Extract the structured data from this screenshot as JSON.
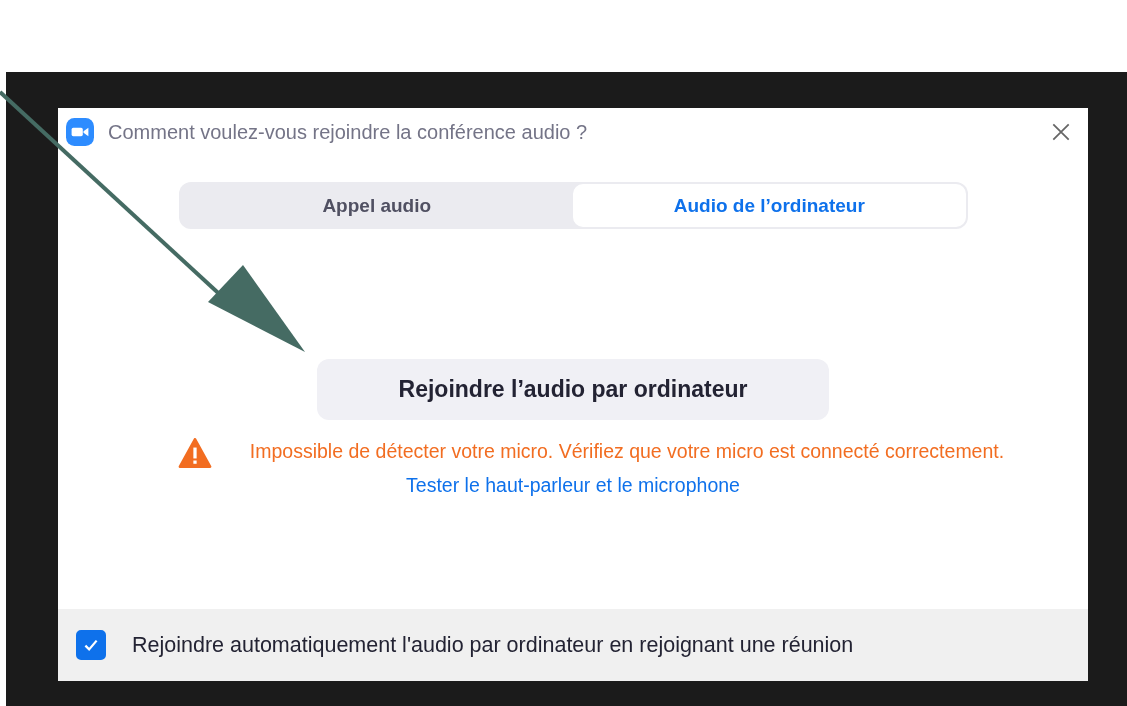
{
  "dialog": {
    "title": "Comment voulez-vous rejoindre la conférence audio ?"
  },
  "tabs": [
    {
      "label": "Appel audio",
      "selected": false
    },
    {
      "label": "Audio de l’ordinateur",
      "selected": true
    }
  ],
  "join_button": "Rejoindre l’audio par ordinateur",
  "warning": "Impossible de détecter votre micro. Vérifiez que votre micro est connecté correctement.",
  "test_link": "Tester le haut-parleur et le microphone",
  "auto_join": {
    "label": "Rejoindre automatiquement l'audio par ordinateur en rejoignant une réunion",
    "checked": true
  }
}
